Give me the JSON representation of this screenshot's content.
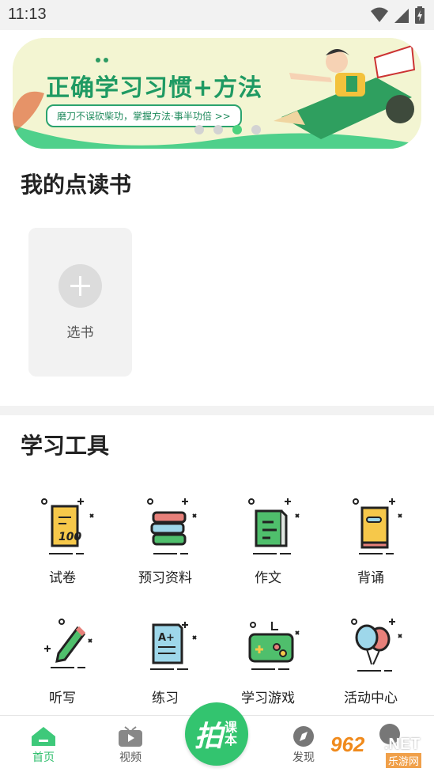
{
  "status_bar": {
    "time": "11:13"
  },
  "banner": {
    "title": "正确学习习惯+方法",
    "subtitle": "磨刀不误砍柴功，掌握方法·事半功倍 >>",
    "dots": 4,
    "active_dot": 3
  },
  "my_books": {
    "title": "我的点读书",
    "add_label": "选书"
  },
  "tools": {
    "title": "学习工具",
    "items": [
      {
        "label": "试卷",
        "icon": "exam-paper-icon"
      },
      {
        "label": "预习资料",
        "icon": "book-stack-icon"
      },
      {
        "label": "作文",
        "icon": "essay-icon"
      },
      {
        "label": "背诵",
        "icon": "recite-book-icon"
      },
      {
        "label": "听写",
        "icon": "pencil-dictation-icon"
      },
      {
        "label": "练习",
        "icon": "graded-paper-icon"
      },
      {
        "label": "学习游戏",
        "icon": "gamepad-icon"
      },
      {
        "label": "活动中心",
        "icon": "balloons-icon"
      }
    ]
  },
  "tabbar": {
    "items": [
      {
        "label": "首页",
        "icon": "home-icon",
        "active": true
      },
      {
        "label": "视频",
        "icon": "tv-icon",
        "active": false
      },
      {
        "label": "发现",
        "icon": "compass-icon",
        "active": false
      }
    ],
    "center": {
      "big": "拍",
      "small": "课本"
    }
  },
  "watermark": {
    "number": "962",
    "suffix": ".NET",
    "sub": "乐游网"
  },
  "colors": {
    "accent": "#33c46f",
    "banner_text": "#1f9a63",
    "card_bg": "#f2f2f2"
  }
}
